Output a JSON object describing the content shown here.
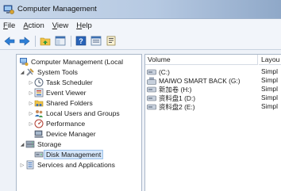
{
  "window": {
    "title": "Computer Management"
  },
  "menu": [
    {
      "label": "File",
      "mnemonic": "F",
      "rest": "ile"
    },
    {
      "label": "Action",
      "mnemonic": "A",
      "rest": "ction"
    },
    {
      "label": "View",
      "mnemonic": "V",
      "rest": "iew"
    },
    {
      "label": "Help",
      "mnemonic": "H",
      "rest": "elp"
    }
  ],
  "toolbar": [
    "back-icon",
    "forward-icon",
    "up-folder-icon",
    "show-hide-tree-icon",
    "help-icon",
    "properties-icon",
    "export-icon"
  ],
  "tree": {
    "root": "Computer Management (Local",
    "system_tools": "System Tools",
    "task_scheduler": "Task Scheduler",
    "event_viewer": "Event Viewer",
    "shared_folders": "Shared Folders",
    "local_users": "Local Users and Groups",
    "performance": "Performance",
    "device_manager": "Device Manager",
    "storage": "Storage",
    "disk_management": "Disk Management",
    "services": "Services and Applications"
  },
  "columns": {
    "volume": "Volume",
    "layout": "Layou"
  },
  "volumes": [
    {
      "name": "(C:)",
      "layout": "Simpl"
    },
    {
      "name": "MAIWO SMART BACK (G:)",
      "layout": "Simpl"
    },
    {
      "name": "新加卷 (H:)",
      "layout": "Simpl"
    },
    {
      "name": "资料盘1 (D:)",
      "layout": "Simpl"
    },
    {
      "name": "资料盘2 (E:)",
      "layout": "Simpl"
    }
  ],
  "colors": {
    "selection": "#d4e6fa",
    "title_gradient_end": "#8fa8c8"
  }
}
